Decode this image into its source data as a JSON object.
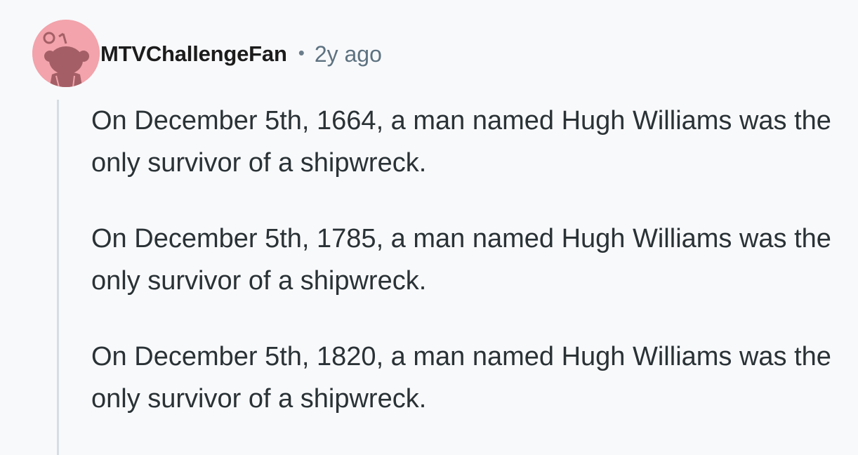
{
  "comment": {
    "author": "MTVChallengeFan",
    "separator": "•",
    "timestamp": "2y ago",
    "avatar_icon": "reddit-snoo-avatar-icon",
    "avatar_bg": "#f2a3ab",
    "avatar_fg": "#a45f66",
    "paragraphs": [
      "On December 5th, 1664, a man named Hugh Williams was the only survivor of a shipwreck.",
      "On December 5th, 1785, a man named Hugh Williams was the only survivor of a shipwreck.",
      "On December 5th, 1820, a man named Hugh Williams was the only survivor of a shipwreck."
    ]
  }
}
